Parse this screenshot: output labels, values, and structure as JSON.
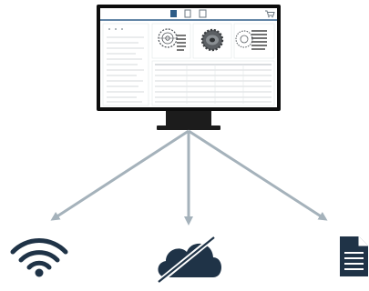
{
  "colors": {
    "monitor_frame": "#0d0d0d",
    "stand": "#1c1c1c",
    "screen_bg": "#ffffff",
    "screen_header": "#ffffff",
    "screen_accent": "#2e5d88",
    "screen_panel": "#f1f3f5",
    "screen_line": "#c7cbcf",
    "arrow": "#a5b2bb",
    "icon_dark": "#1f3347",
    "icon_slash": "#ffffff"
  },
  "icons": {
    "wifi": "wifi-icon",
    "cloud_off": "cloud-off-icon",
    "document": "document-icon",
    "cart": "cart-icon",
    "gear": "gear-icon"
  }
}
